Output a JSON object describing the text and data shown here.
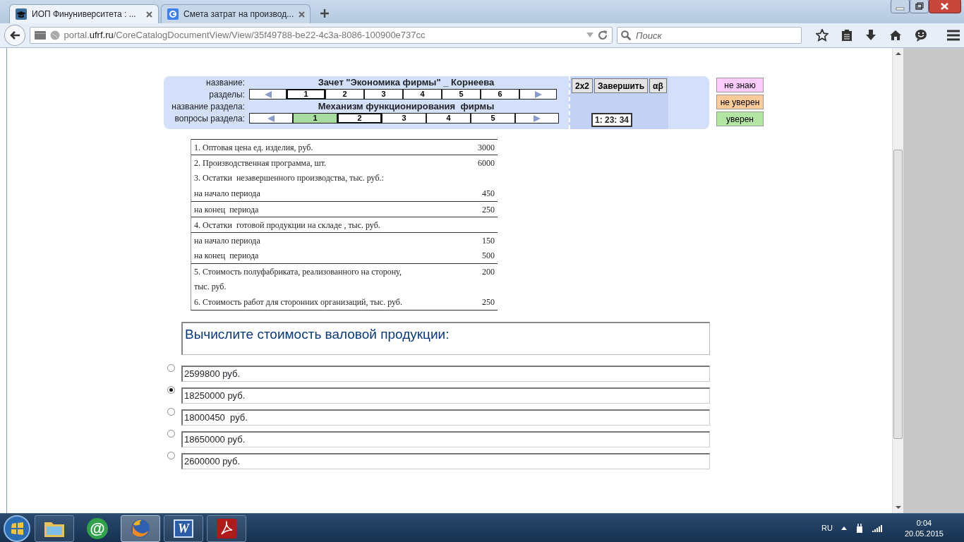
{
  "browser": {
    "tabs": [
      {
        "title": "ИОП Финуниверситета : ...",
        "selected": true
      },
      {
        "title": "Смета затрат на производ...",
        "selected": false
      }
    ],
    "address": {
      "prefix": "portal.",
      "domain": "ufrf.ru",
      "path": "/CoreCatalogDocumentView/View/35f49788-be22-4c3a-8086-100900e737cc"
    },
    "search": {
      "placeholder": "Поиск"
    }
  },
  "quiz": {
    "name_label": "название:",
    "name": "Зачет \"Экономика фирмы\" _ Корнеева",
    "sections_label": "разделы:",
    "sections": [
      {
        "label": "1",
        "selected": true
      },
      {
        "label": "2",
        "selected": false
      },
      {
        "label": "3",
        "selected": false
      },
      {
        "label": "4",
        "selected": false
      },
      {
        "label": "5",
        "selected": false
      },
      {
        "label": "6",
        "selected": false
      }
    ],
    "section_name_label": "название раздела:",
    "section_name": "Механизм функционирования  фирмы",
    "questions_label": "вопросы раздела:",
    "questions": [
      {
        "label": "1",
        "selected": false,
        "answered": true
      },
      {
        "label": "2",
        "selected": true,
        "answered": false
      },
      {
        "label": "3",
        "selected": false,
        "answered": false
      },
      {
        "label": "4",
        "selected": false,
        "answered": false
      },
      {
        "label": "5",
        "selected": false,
        "answered": false
      }
    ],
    "tools": [
      "2x2",
      "Завершить",
      "αβ"
    ],
    "timer": "1: 23: 34",
    "confidence": [
      {
        "label": "не знаю",
        "color": "#ffccff"
      },
      {
        "label": "не уверен",
        "color": "#ffcc99"
      },
      {
        "label": "уверен",
        "color": "#b3e6a3"
      }
    ]
  },
  "data_table": {
    "rows": [
      {
        "text": "1. Оптовая цена ед. изделия, руб.",
        "value": "3000",
        "rule_above": true
      },
      {
        "text": "2. Производственная программа, шт.",
        "value": "6000",
        "rule_above": true
      },
      {
        "text": "3. Остатки  незавершенного производства, тыс. руб.:",
        "rule_above": false
      },
      {
        "text": "на начало периода",
        "value": "450",
        "rule_above": false
      },
      {
        "text": "на конец  периода",
        "value": "250",
        "rule_above": true
      },
      {
        "text": "4. Остатки  готовой продукции на складе , тыс. руб.",
        "rule_above": true
      },
      {
        "text": "на начало периода",
        "value": "150",
        "rule_above": true
      },
      {
        "text": "на конец  периода",
        "value": "500",
        "rule_above": false
      },
      {
        "text": "5. Стоимость полуфабриката, реализованного на сторону,",
        "value": "200",
        "rule_above": true
      },
      {
        "text": "тыс. руб.",
        "rule_above": false
      },
      {
        "text": "6. Стоимость работ для сторонних организаций, тыс. руб.",
        "value": "250",
        "rule_above": false
      }
    ]
  },
  "question": "Вычислите стоимость валовой продукции:",
  "answers": [
    {
      "text": "2599800 руб.",
      "selected": false
    },
    {
      "text": "18250000 руб.",
      "selected": true
    },
    {
      "text": "18000450  руб.",
      "selected": false
    },
    {
      "text": "18650000 руб.",
      "selected": false
    },
    {
      "text": "2600000 руб.",
      "selected": false
    }
  ],
  "taskbar": {
    "apps": [
      {
        "kind": "folder",
        "running": true,
        "active": false
      },
      {
        "kind": "agent",
        "glyph": "@",
        "running": false,
        "active": false
      },
      {
        "kind": "firefox",
        "running": true,
        "active": true
      },
      {
        "kind": "word",
        "glyph": "W",
        "running": true,
        "active": false
      },
      {
        "kind": "acrobat",
        "running": true,
        "active": false
      }
    ],
    "language": "RU",
    "time": "0:04",
    "date": "20.05.2015"
  }
}
